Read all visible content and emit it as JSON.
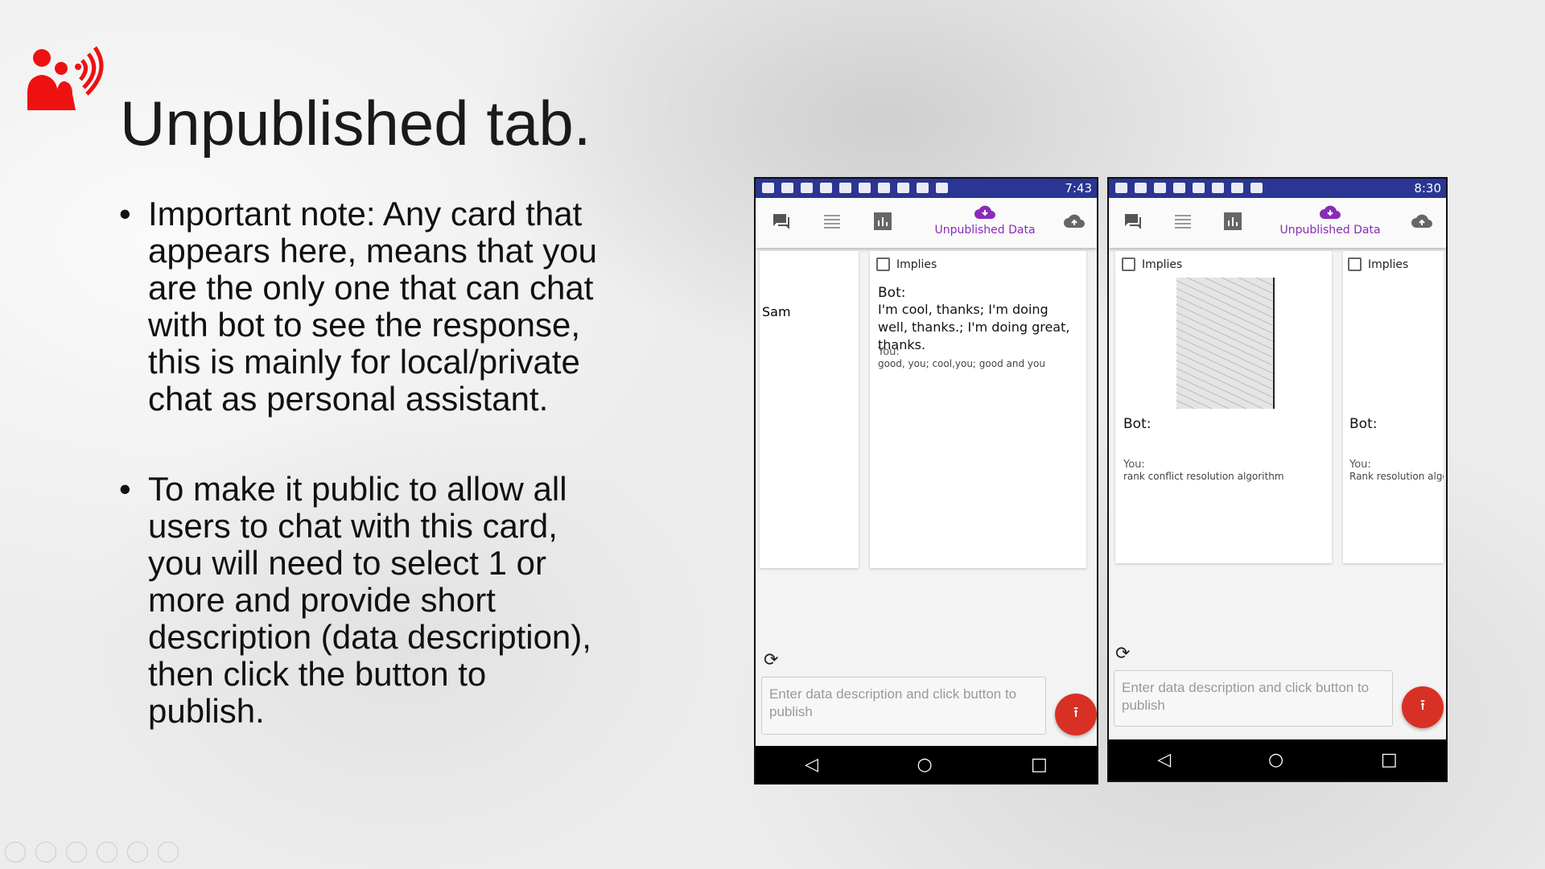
{
  "slide": {
    "title": "Unpublished tab.",
    "bullets": [
      "Important note: Any card that appears here, means that you are the only one that can chat with bot to see the response, this is mainly for local/private chat as personal assistant.",
      "To make it public to allow all users to chat with this card, you will need to select 1 or more and provide short description (data description), then click the button to publish."
    ]
  },
  "phone1": {
    "time": "7:43",
    "active_tab": "Unpublished Data",
    "left_card": {
      "name": "Sam"
    },
    "card": {
      "checkbox_label": "Implies",
      "bot_label": "Bot:",
      "bot_text": "I'm cool, thanks; I'm doing well, thanks.; I'm doing great, thanks.",
      "you_label": "You:",
      "you_text": "good, you; cool,you; good and you"
    },
    "input_placeholder": "Enter data description and click button to publish"
  },
  "phone2": {
    "time": "8:30",
    "active_tab": "Unpublished Data",
    "cards": [
      {
        "checkbox_label": "Implies",
        "bot_label": "Bot:",
        "you_label": "You:",
        "you_text": "rank conflict resolution algorithm"
      },
      {
        "checkbox_label": "Implies",
        "bot_label": "Bot:",
        "you_label": "You:",
        "you_text": "Rank resolution algo"
      }
    ],
    "input_placeholder": "Enter data description and click button to publish"
  },
  "colors": {
    "status_bar": "#2b3593",
    "accent": "#8a2bb8",
    "fab": "#d93025",
    "logo": "#ee1111"
  }
}
